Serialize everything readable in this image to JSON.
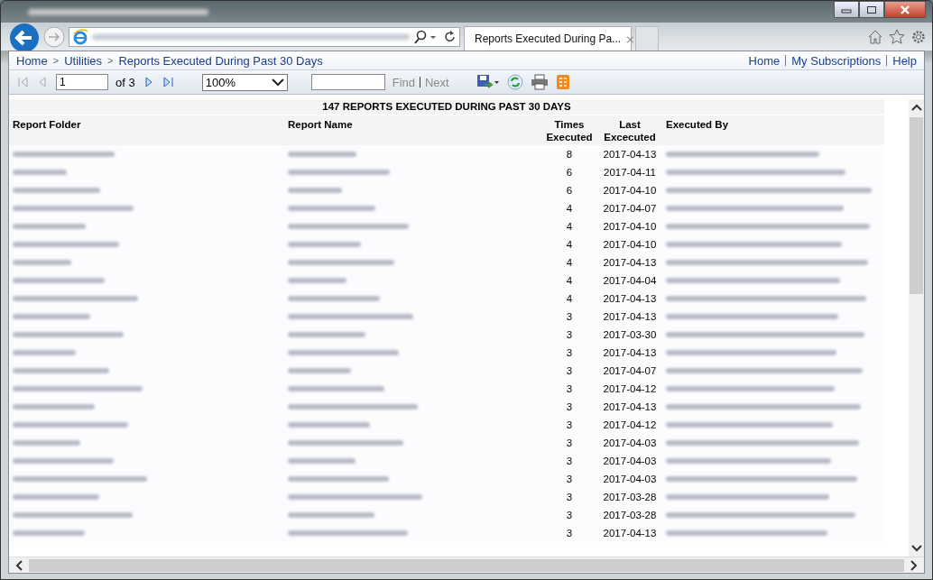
{
  "browser": {
    "tab": {
      "title": "Reports Executed During Pa...",
      "close": "×"
    }
  },
  "breadcrumb": [
    {
      "label": "Home"
    },
    {
      "label": "Utilities"
    },
    {
      "label": "Reports Executed During Past 30 Days"
    }
  ],
  "breadcrumb_separator": ">",
  "top_links": [
    "Home",
    "My Subscriptions",
    "Help"
  ],
  "toolbar": {
    "page": "1",
    "of": "of 3",
    "zoom": "100%",
    "find": "Find",
    "next": "Next"
  },
  "report": {
    "title": "147 REPORTS EXECUTED DURING PAST 30 DAYS",
    "columns": [
      {
        "label": "Report Folder"
      },
      {
        "label": "Report Name"
      },
      {
        "label": "Times Executed"
      },
      {
        "label": "Last Excecuted"
      },
      {
        "label": "Executed By"
      }
    ],
    "rows": [
      {
        "times": "8",
        "last": "2017-04-13"
      },
      {
        "times": "6",
        "last": "2017-04-11"
      },
      {
        "times": "6",
        "last": "2017-04-10"
      },
      {
        "times": "4",
        "last": "2017-04-07"
      },
      {
        "times": "4",
        "last": "2017-04-10"
      },
      {
        "times": "4",
        "last": "2017-04-10"
      },
      {
        "times": "4",
        "last": "2017-04-13"
      },
      {
        "times": "4",
        "last": "2017-04-04"
      },
      {
        "times": "4",
        "last": "2017-04-13"
      },
      {
        "times": "3",
        "last": "2017-04-13"
      },
      {
        "times": "3",
        "last": "2017-03-30"
      },
      {
        "times": "3",
        "last": "2017-04-13"
      },
      {
        "times": "3",
        "last": "2017-04-07"
      },
      {
        "times": "3",
        "last": "2017-04-12"
      },
      {
        "times": "3",
        "last": "2017-04-13"
      },
      {
        "times": "3",
        "last": "2017-04-12"
      },
      {
        "times": "3",
        "last": "2017-04-03"
      },
      {
        "times": "3",
        "last": "2017-04-03"
      },
      {
        "times": "3",
        "last": "2017-04-03"
      },
      {
        "times": "3",
        "last": "2017-03-28"
      },
      {
        "times": "3",
        "last": "2017-03-28"
      },
      {
        "times": "3",
        "last": "2017-04-13"
      }
    ]
  }
}
